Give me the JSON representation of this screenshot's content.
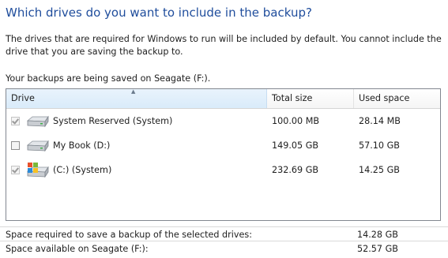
{
  "heading": "Which drives do you want to include in the backup?",
  "description": "The drives that are required for Windows to run will be included by default. You cannot include the drive that you are saving the backup to.",
  "saving_text": "Your backups are being saved on Seagate (F:).",
  "table": {
    "columns": [
      "Drive",
      "Total size",
      "Used space"
    ],
    "rows": [
      {
        "drive": "System Reserved (System)",
        "total": "100.00 MB",
        "used": "28.14 MB",
        "checked": true,
        "disabled": true,
        "icon": "hard-drive-icon"
      },
      {
        "drive": "My Book (D:)",
        "total": "149.05 GB",
        "used": "57.10 GB",
        "checked": false,
        "disabled": false,
        "icon": "hard-drive-icon"
      },
      {
        "drive": "(C:) (System)",
        "total": "232.69 GB",
        "used": "14.25 GB",
        "checked": true,
        "disabled": true,
        "icon": "windows-drive-icon"
      }
    ]
  },
  "footer": {
    "required_label": "Space required to save a backup of the selected drives:",
    "required_value": "14.28 GB",
    "available_label": "Space available on Seagate (F:):",
    "available_value": "52.57 GB"
  }
}
